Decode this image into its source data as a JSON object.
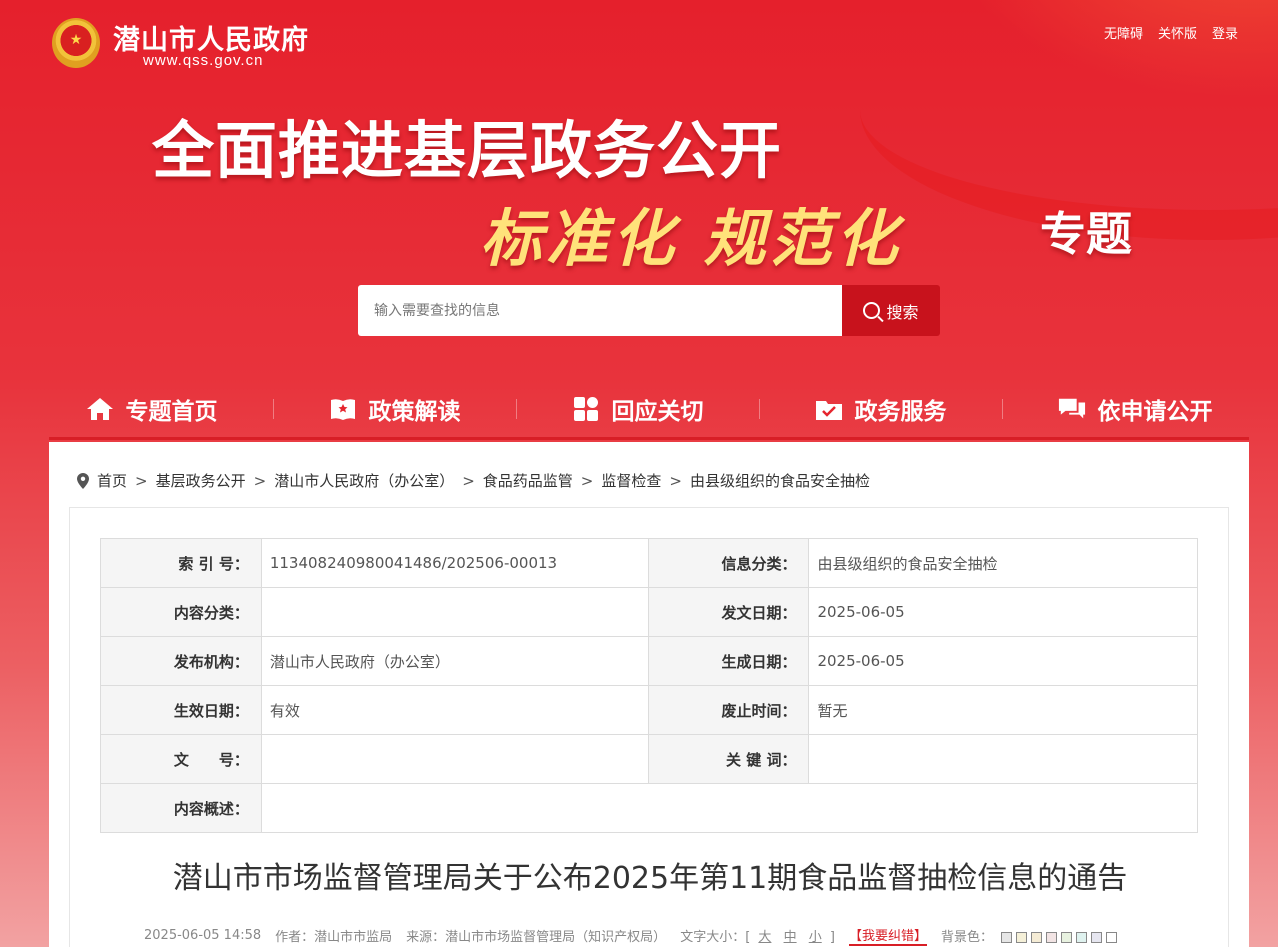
{
  "header": {
    "site_name": "潜山市人民政府",
    "site_url": "www.qss.gov.cn",
    "top_links": [
      "无障碍",
      "关怀版",
      "登录"
    ]
  },
  "banner": {
    "line1": "全面推进基层政务公开",
    "line2": "标准化 规范化",
    "line3": "专题"
  },
  "search": {
    "placeholder": "输入需要查找的信息",
    "button_label": "搜索"
  },
  "nav": [
    {
      "label": "专题首页",
      "icon": "home-icon"
    },
    {
      "label": "政策解读",
      "icon": "book-icon"
    },
    {
      "label": "回应关切",
      "icon": "grid-icon"
    },
    {
      "label": "政务服务",
      "icon": "folder-check-icon"
    },
    {
      "label": "依申请公开",
      "icon": "chat-icon"
    }
  ],
  "breadcrumb": [
    "首页",
    "基层政务公开",
    "潜山市人民政府（办公室）",
    "食品药品监管",
    "监督检查",
    "由县级组织的食品安全抽检"
  ],
  "meta": {
    "index_label": "索 引 号：",
    "index_value": "113408240980041486/202506-00013",
    "info_cat_label": "信息分类：",
    "info_cat_value": "由县级组织的食品安全抽检",
    "content_cat_label": "内容分类：",
    "content_cat_value": "",
    "issue_date_label": "发文日期：",
    "issue_date_value": "2025-06-05",
    "org_label": "发布机构：",
    "org_value": "潜山市人民政府（办公室）",
    "gen_date_label": "生成日期：",
    "gen_date_value": "2025-06-05",
    "effective_label": "生效日期：",
    "effective_value": "有效",
    "expire_label": "废止时间：",
    "expire_value": "暂无",
    "doc_no_label": "文　　号：",
    "doc_no_value": "",
    "keywords_label": "关 键 词：",
    "keywords_value": "",
    "summary_label": "内容概述：",
    "summary_value": ""
  },
  "document": {
    "title": "潜山市市场监督管理局关于公布2025年第11期食品监督抽检信息的通告",
    "datetime": "2025-06-05 14:58",
    "author": "作者：潜山市市监局",
    "source": "来源：潜山市市场监督管理局（知识产权局）",
    "font_size_label": "文字大小：[",
    "font_sizes": [
      "大",
      "中",
      "小"
    ],
    "font_size_close": "]",
    "error_report": "【我要纠错】",
    "bg_color_label": "背景色：",
    "bg_colors": [
      "#e6e6e6",
      "#f5f0d8",
      "#f5ecd5",
      "#f2e4e4",
      "#e8f2e0",
      "#dff2ef",
      "#e6e6f0",
      "#ffffff"
    ]
  }
}
